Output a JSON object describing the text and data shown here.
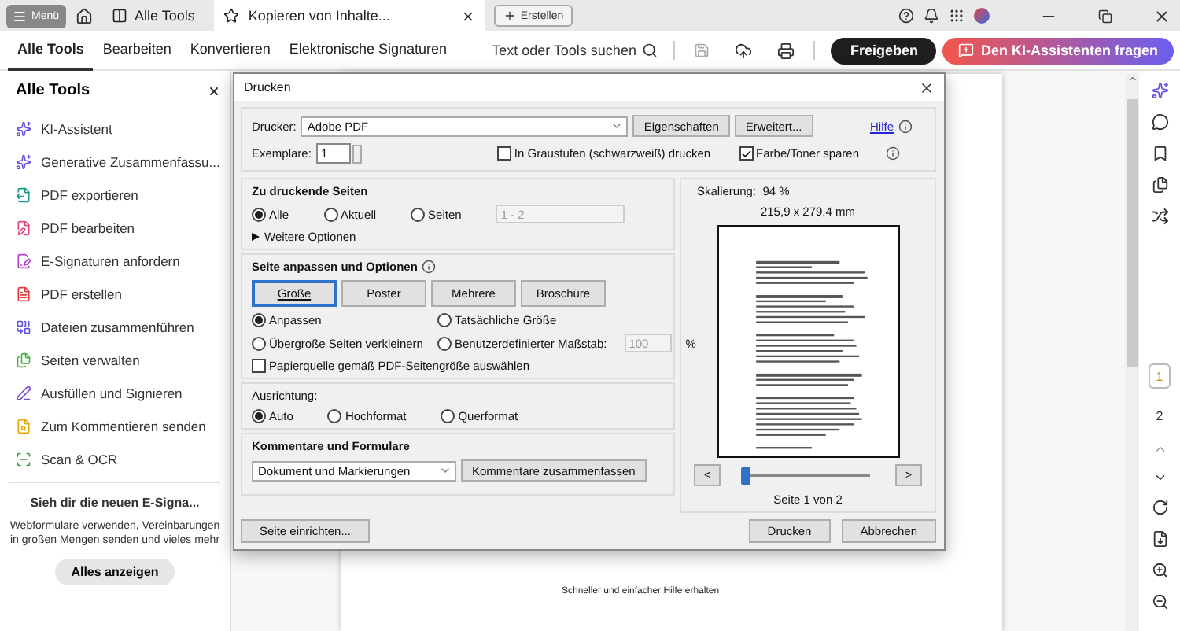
{
  "top_bar": {
    "menu": "Menü",
    "home_tab": "Alle Tools",
    "doc_tab": "Kopieren von Inhalte...",
    "create": "Erstellen"
  },
  "toolbar": {
    "tabs": [
      {
        "label": "Alle Tools",
        "selected": true
      },
      {
        "label": "Bearbeiten",
        "selected": false
      },
      {
        "label": "Konvertieren",
        "selected": false
      },
      {
        "label": "Elektronische Signaturen",
        "selected": false
      }
    ],
    "search": "Text oder Tools suchen",
    "share": "Freigeben",
    "ai": "Den KI-Assistenten fragen"
  },
  "sidebar": {
    "title": "Alle Tools",
    "items": [
      {
        "label": "KI-Assistent",
        "color": "#6a4fe0"
      },
      {
        "label": "Generative Zusammenfassu...",
        "color": "#6a4fe0"
      },
      {
        "label": "PDF exportieren",
        "color": "#1a9a8a"
      },
      {
        "label": "PDF bearbeiten",
        "color": "#e0457b"
      },
      {
        "label": "E-Signaturen anfordern",
        "color": "#b53fc9"
      },
      {
        "label": "PDF erstellen",
        "color": "#e03a3a"
      },
      {
        "label": "Dateien zusammenführen",
        "color": "#5b4fe0"
      },
      {
        "label": "Seiten verwalten",
        "color": "#4caf50"
      },
      {
        "label": "Ausfüllen und Signieren",
        "color": "#7b4fd0"
      },
      {
        "label": "Zum Kommentieren senden",
        "color": "#e0a800"
      },
      {
        "label": "Scan & OCR",
        "color": "#3a9a4a"
      }
    ],
    "promo": {
      "title": "Sieh dir die neuen E-Signa...",
      "text": "Webformulare verwenden, Vereinbarungen in großen Mengen senden und vieles mehr",
      "button": "Alles anzeigen"
    }
  },
  "document": {
    "text": "Schneller und einfacher Hilfe erhalten"
  },
  "dialog": {
    "title": "Drucken",
    "printer_label": "Drucker:",
    "printer": "Adobe PDF",
    "properties": "Eigenschaften",
    "advanced": "Erweitert...",
    "help": "Hilfe",
    "copies_label": "Exemplare:",
    "copies": "1",
    "grayscale": {
      "label": "In Graustufen (schwarzweiß) drucken",
      "checked": false
    },
    "save_toner": {
      "label": "Farbe/Toner sparen",
      "checked": true
    },
    "pages": {
      "title": "Zu druckende Seiten",
      "options": [
        {
          "label": "Alle",
          "selected": true
        },
        {
          "label": "Aktuell",
          "selected": false
        },
        {
          "label": "Seiten",
          "selected": false
        }
      ],
      "range": "1 - 2",
      "more": "Weitere Optionen"
    },
    "fit": {
      "title": "Seite anpassen und Optionen",
      "modes": [
        {
          "label": "Größe",
          "selected": true
        },
        {
          "label": "Poster",
          "selected": false
        },
        {
          "label": "Mehrere",
          "selected": false
        },
        {
          "label": "Broschüre",
          "selected": false
        }
      ],
      "options": [
        {
          "label": "Anpassen",
          "selected": true
        },
        {
          "label": "Tatsächliche Größe",
          "selected": false
        },
        {
          "label": "Übergroße Seiten verkleinern",
          "selected": false
        },
        {
          "label": "Benutzerdefinierter Maßstab:",
          "selected": false
        }
      ],
      "scale": "100",
      "percent": "%",
      "paper_source": {
        "label": "Papierquelle gemäß PDF-Seitengröße auswählen",
        "checked": false
      }
    },
    "orientation": {
      "title": "Ausrichtung:",
      "options": [
        {
          "label": "Auto",
          "selected": true
        },
        {
          "label": "Hochformat",
          "selected": false
        },
        {
          "label": "Querformat",
          "selected": false
        }
      ]
    },
    "comments": {
      "title": "Kommentare und Formulare",
      "select": "Dokument und Markierungen",
      "summarize": "Kommentare zusammenfassen"
    },
    "preview": {
      "scaling": "Skalierung:  94 %",
      "size": "215,9 x 279,4 mm",
      "prev": "<",
      "next": ">",
      "level": 0,
      "page_label": "Seite 1 von 2"
    },
    "page_setup": "Seite einrichten...",
    "print": "Drucken",
    "cancel": "Abbrechen"
  },
  "right_rail": {
    "pages": [
      {
        "label": "1",
        "selected": true
      },
      {
        "label": "2",
        "selected": false
      }
    ]
  }
}
